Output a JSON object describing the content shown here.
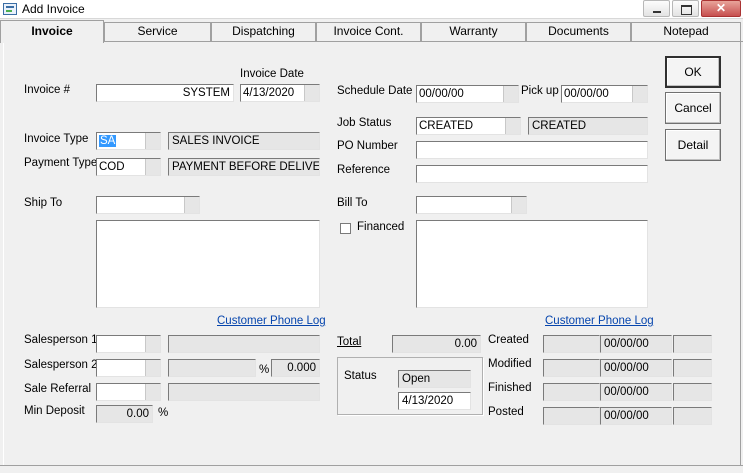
{
  "window": {
    "title": "Add Invoice",
    "close_glyph": "✕"
  },
  "tabs": [
    "Invoice",
    "Service",
    "Dispatching",
    "Invoice Cont.",
    "Warranty",
    "Documents",
    "Notepad"
  ],
  "buttons": {
    "ok": "OK",
    "cancel": "Cancel",
    "detail": "Detail"
  },
  "invoice": {
    "number_label": "Invoice #",
    "number_value": "SYSTEM",
    "date_label": "Invoice Date",
    "date_value": "4/13/2020",
    "type_label": "Invoice Type",
    "type_code": "SA",
    "type_desc": "SALES INVOICE",
    "payment_label": "Payment Type",
    "payment_code": "COD",
    "payment_desc": "PAYMENT BEFORE DELIVER",
    "ship_to_label": "Ship To",
    "ship_to_value": "",
    "ship_to_address": "",
    "phone_log_left": "Customer Phone Log",
    "sp1_label": "Salesperson 1",
    "sp2_label": "Salesperson 2",
    "sp2_percent_sign": "%",
    "sp2_percent": "0.000",
    "referral_label": "Sale Referral",
    "min_deposit_label": "Min Deposit",
    "min_deposit_value": "0.00",
    "min_deposit_pct": "%"
  },
  "schedule": {
    "schedule_label": "Schedule Date",
    "schedule_value": "00/00/00",
    "pickup_label": "Pick up",
    "pickup_value": "00/00/00",
    "job_status_label": "Job Status",
    "job_status_value": "CREATED",
    "job_status_desc": "CREATED",
    "po_label": "PO Number",
    "po_value": "",
    "reference_label": "Reference",
    "reference_value": "",
    "bill_to_label": "Bill To",
    "bill_to_value": "",
    "financed_label": "Financed",
    "financed_checked": false,
    "bill_to_address": "",
    "phone_log_right": "Customer Phone Log"
  },
  "totals": {
    "total_label": "Total",
    "total_value": "0.00",
    "status_label": "Status",
    "status_value": "Open",
    "status_date": "4/13/2020",
    "created_label": "Created",
    "modified_label": "Modified",
    "finished_label": "Finished",
    "posted_label": "Posted",
    "created_date": "00/00/00",
    "modified_date": "00/00/00",
    "finished_date": "00/00/00",
    "posted_date": "00/00/00"
  }
}
